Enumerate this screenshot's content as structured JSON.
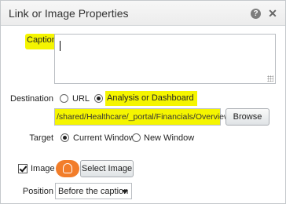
{
  "dialog": {
    "title": "Link or Image Properties",
    "help_icon": "question-mark-icon",
    "close_icon": "close-icon"
  },
  "caption": {
    "label": "Caption",
    "value": ""
  },
  "destination": {
    "label": "Destination",
    "options": [
      {
        "label": "URL",
        "selected": false
      },
      {
        "label": "Analysis or Dashboard",
        "selected": true
      }
    ],
    "path": "/shared/Healthcare/_portal/Financials/Overview",
    "browse_label": "Browse"
  },
  "target": {
    "label": "Target",
    "options": [
      {
        "label": "Current Window",
        "selected": true
      },
      {
        "label": "New Window",
        "selected": false
      }
    ]
  },
  "image": {
    "label": "Image",
    "checked": true,
    "select_label": "Select Image"
  },
  "position": {
    "label": "Position",
    "selected": "Before the caption"
  },
  "colors": {
    "highlight": "#f5f500",
    "image_icon": "#f27d2a"
  }
}
